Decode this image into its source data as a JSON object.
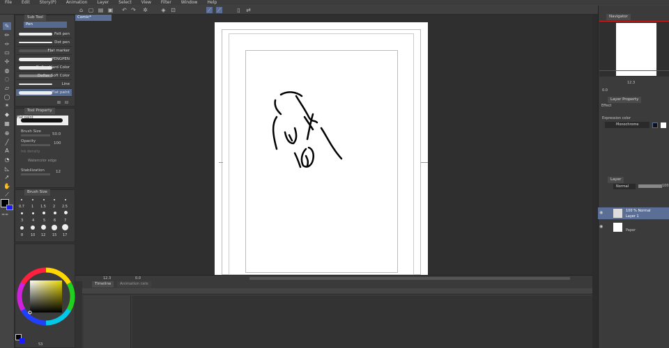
{
  "menu": [
    "File",
    "Edit",
    "Story(P)",
    "Animation",
    "Layer",
    "Select",
    "View",
    "Filter",
    "Window",
    "Help"
  ],
  "doc_tab": "Comic*",
  "sub_tool": {
    "tab": "Sub Tool",
    "active_group": "Pen",
    "brushes": [
      "Felt pen",
      "Dot pen",
      "Flat marker",
      "PENGPEN",
      "Defter Hard Color",
      "Defter Soft Color",
      "Line",
      "Flat paint"
    ],
    "selected": "Flat paint"
  },
  "tool_property": {
    "tab": "Tool Property",
    "brush_name": "Flat paint",
    "brush_size_label": "Brush Size",
    "brush_size": "50.0",
    "opacity_label": "Opacity",
    "opacity": "100",
    "ink_label": "Ink density",
    "watercolor_label": "Watercolor edge",
    "stabilization_label": "Stabilization",
    "stabilization": "12"
  },
  "brush_size_panel": {
    "tab": "Brush Size",
    "sizes_row1": [
      "0.7",
      "1",
      "1.5",
      "2",
      "2.5"
    ],
    "sizes_row2": [
      "3",
      "4",
      "5",
      "6",
      "7"
    ],
    "sizes_row3": [
      "8",
      "10",
      "12",
      "15",
      "17"
    ]
  },
  "color": {
    "accent": "#5a6e96",
    "main": "#000000",
    "sub": "#1a1aff",
    "bg": "#2f2f2f"
  },
  "color_value": "53",
  "canvas_zoom": "12.3",
  "canvas_angle": "0.0",
  "timeline": {
    "tab": "Timeline",
    "tab2": "Animation cels"
  },
  "navigator": {
    "tab": "Navigator",
    "zoom": "12.3",
    "angle": "0.0"
  },
  "layer_prop": {
    "tab": "Layer Property",
    "effect_label": "Effect",
    "expression_label": "Expression color",
    "expression_value": "Monochrome"
  },
  "layer_panel": {
    "tab": "Layer",
    "blend": "Normal",
    "opacity": "100",
    "layers": [
      {
        "line1": "100 % Normal",
        "line2": "Layer 1",
        "selected": true
      },
      {
        "line1": "",
        "line2": "Paper",
        "selected": false
      }
    ]
  }
}
